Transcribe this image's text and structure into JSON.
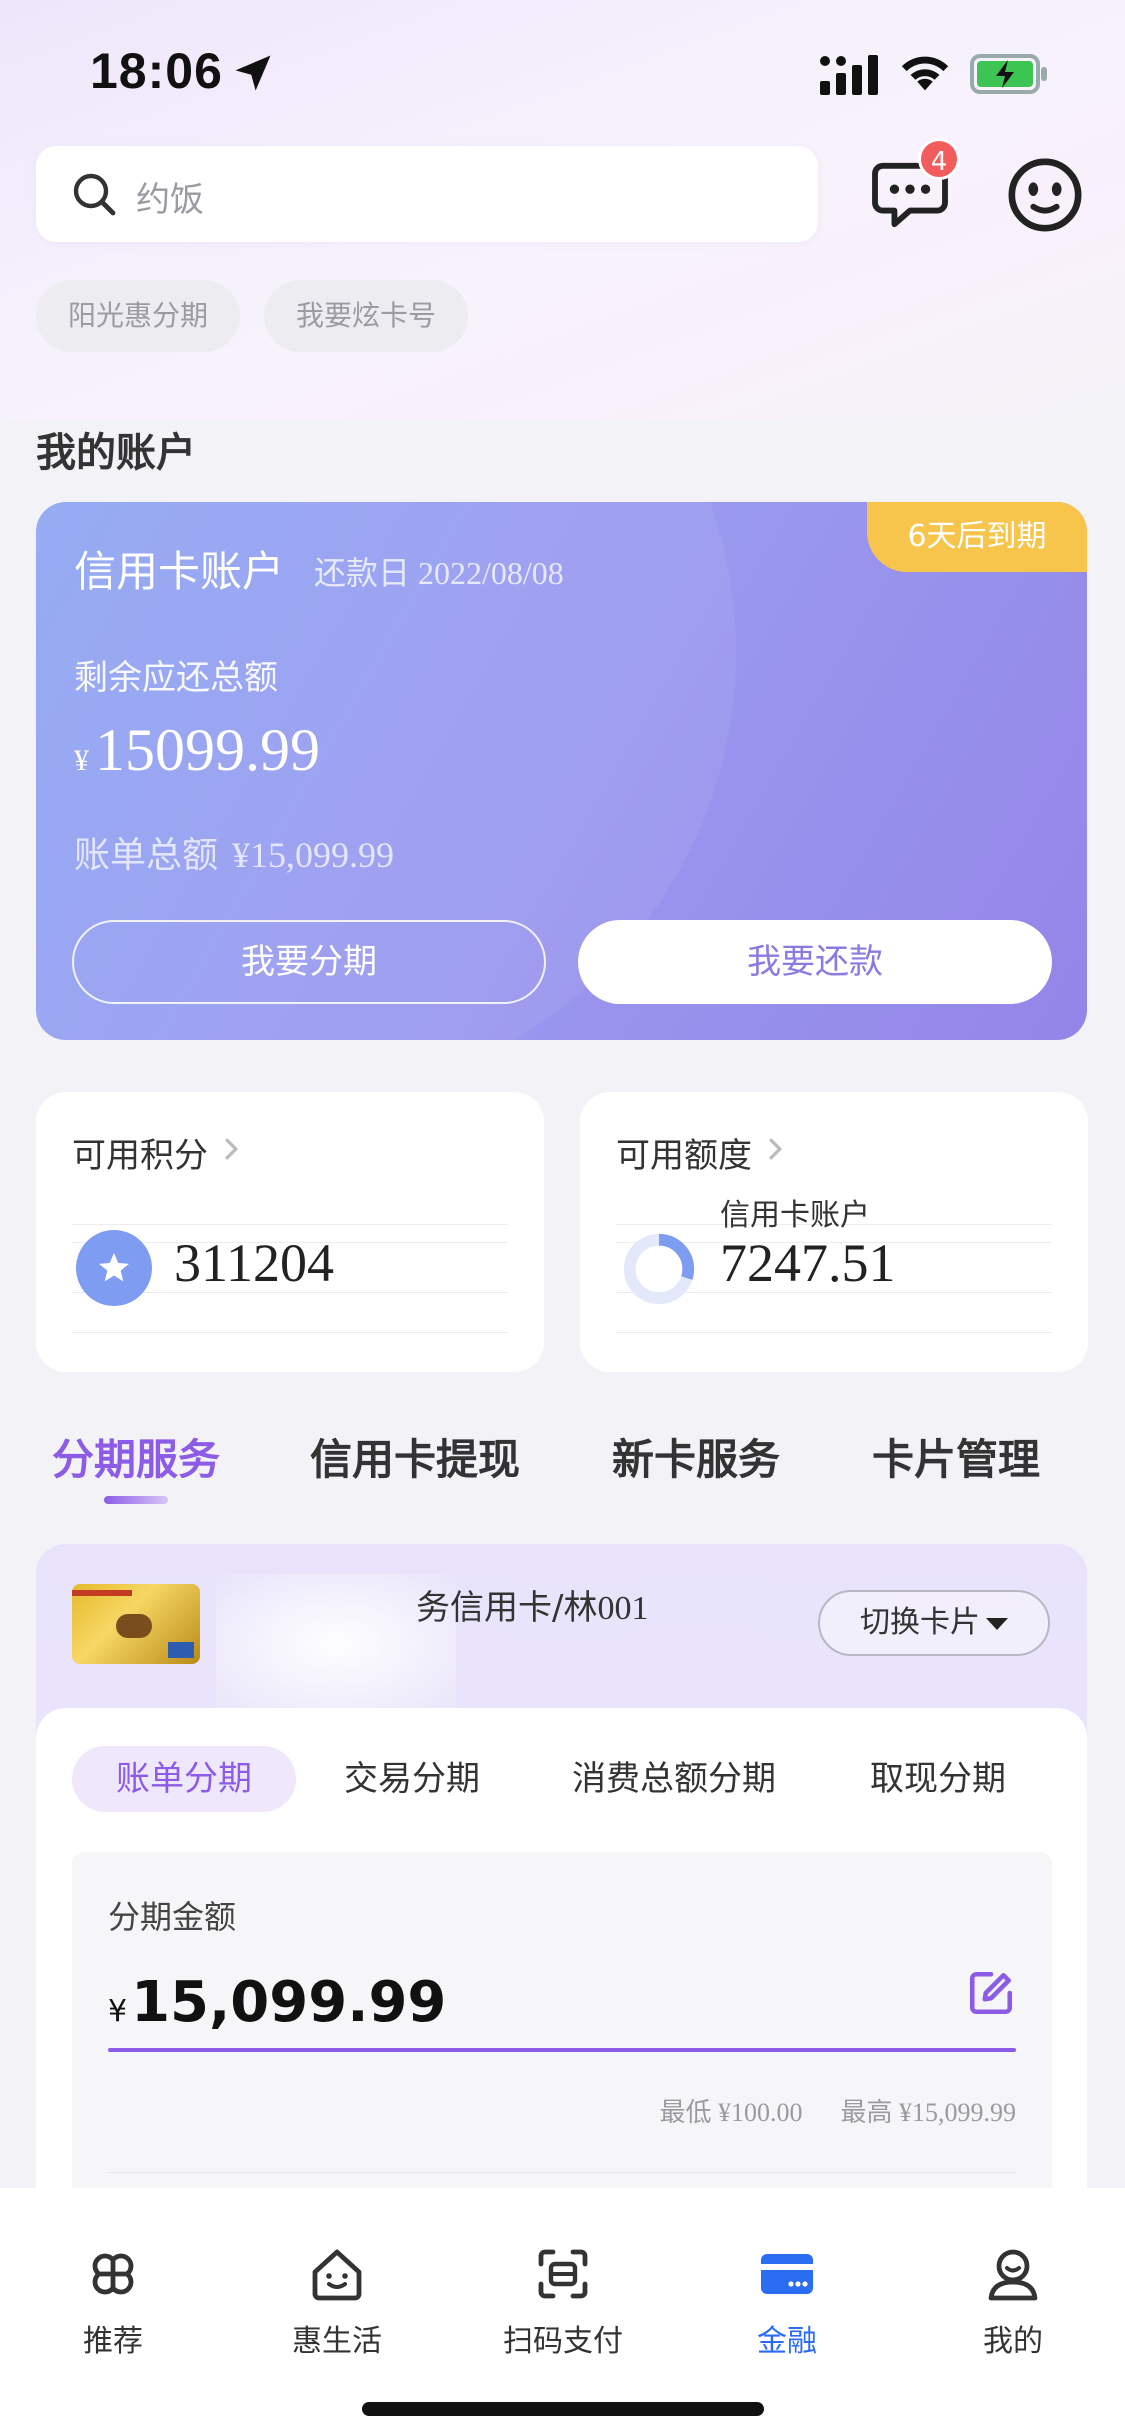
{
  "status_bar": {
    "time": "18:06"
  },
  "search": {
    "placeholder": "约饭"
  },
  "messages": {
    "badge_count": "4"
  },
  "tags": [
    "阳光惠分期",
    "我要炫卡号"
  ],
  "account_section": {
    "title": "我的账户"
  },
  "credit_card": {
    "title": "信用卡账户",
    "due_label": "还款日",
    "due_date": "2022/08/08",
    "due_badge": "6天后到期",
    "remaining_label": "剩余应还总额",
    "currency": "¥",
    "remaining_amount": "15099.99",
    "bill_total_label": "账单总额",
    "bill_total_value": "¥15,099.99",
    "installment_button": "我要分期",
    "repay_button": "我要还款"
  },
  "points_card": {
    "title": "可用积分",
    "value": "311204"
  },
  "limit_card": {
    "title": "可用额度",
    "subtitle": "信用卡账户",
    "value": "7247.51",
    "ring_fraction": 0.3
  },
  "service_tabs": [
    {
      "label": "分期服务",
      "active": true
    },
    {
      "label": "信用卡提现",
      "active": false
    },
    {
      "label": "新卡服务",
      "active": false
    },
    {
      "label": "卡片管理",
      "active": false
    }
  ],
  "installment": {
    "card_name_prefix": "务信用卡/",
    "card_name_suffix": "林001",
    "switch_button": "切换卡片",
    "sub_tabs": [
      {
        "label": "账单分期",
        "active": true
      },
      {
        "label": "交易分期",
        "active": false
      },
      {
        "label": "消费总额分期",
        "active": false
      },
      {
        "label": "取现分期",
        "active": false
      }
    ],
    "amount_label": "分期金额",
    "currency": "¥",
    "amount_value": "15,099.99",
    "min_label": "最低 ¥100.00",
    "max_label": "最高 ¥15,099.99"
  },
  "bottom_nav": [
    {
      "label": "推荐",
      "icon": "grid-icon",
      "active": false
    },
    {
      "label": "惠生活",
      "icon": "house-icon",
      "active": false
    },
    {
      "label": "扫码支付",
      "icon": "scan-icon",
      "active": false
    },
    {
      "label": "金融",
      "icon": "card-icon",
      "active": true
    },
    {
      "label": "我的",
      "icon": "user-icon",
      "active": false
    }
  ],
  "colors": {
    "accent": "#8c5ce6",
    "nav_active": "#2a6cf2",
    "badge": "#f8c54c"
  }
}
